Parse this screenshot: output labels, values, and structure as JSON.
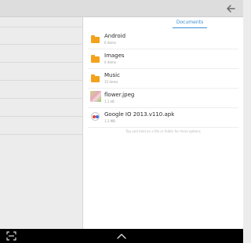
{
  "header": {
    "back_icon": "arrow-back-icon"
  },
  "tabs": [
    {
      "label": "Documents"
    }
  ],
  "files": [
    {
      "name": "Android",
      "meta": "6 items",
      "icon": "folder-icon"
    },
    {
      "name": "Images",
      "meta": "0 items",
      "icon": "folder-icon"
    },
    {
      "name": "Music",
      "meta": "15 items",
      "icon": "folder-icon"
    },
    {
      "name": "flower.jpeg",
      "meta": "1.1 kB",
      "icon": "image-thumbnail"
    },
    {
      "name": "Google IO 2013.v110.apk",
      "meta": "1.3 MB",
      "icon": "apk-icon"
    }
  ],
  "hint": "Tap and hold on a file or folder for more options",
  "navbar": {
    "left_icon": "expand-icon",
    "center_icon": "chevron-up-icon"
  },
  "colors": {
    "accent": "#3b8fd6",
    "folder": "#f4a21c",
    "navbar": "#000000"
  }
}
